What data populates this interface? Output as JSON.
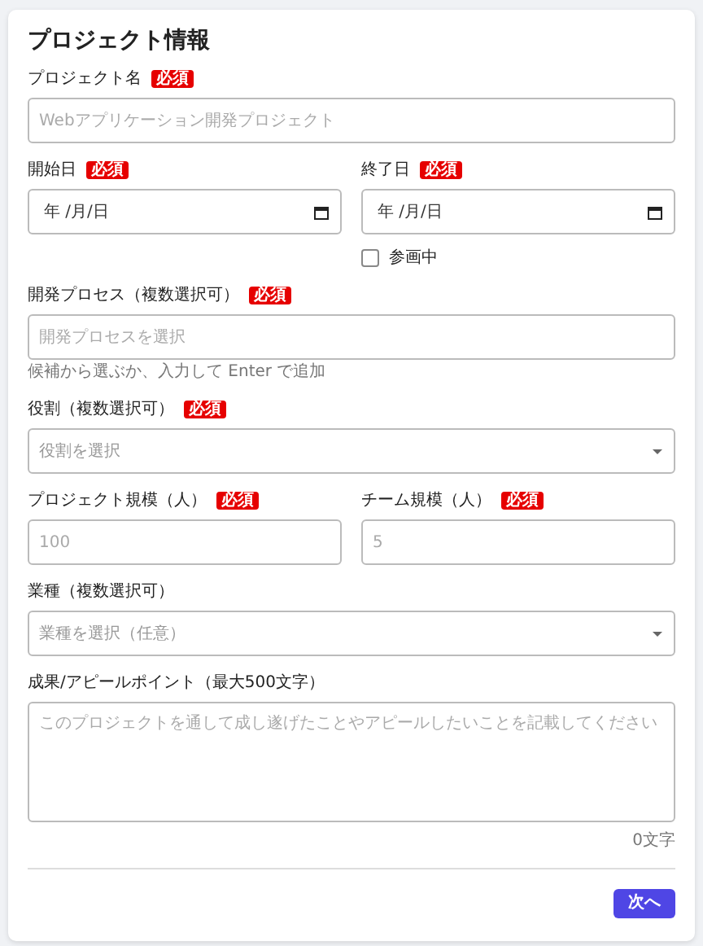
{
  "title": "プロジェクト情報",
  "rows": [
    {
      "fields": [
        {
          "kind": "text",
          "label": "プロジェクト名",
          "badge": "必須",
          "placeholder": "Webアプリケーション開発プロジェクト"
        }
      ]
    },
    {
      "fields": [
        {
          "kind": "date",
          "label": "開始日",
          "badge": "必須",
          "display": "年 /月/日"
        },
        {
          "kind": "date",
          "label": "終了日",
          "badge": "必須",
          "display": "年 /月/日",
          "checkbox": {
            "label": "参画中",
            "checked": false
          }
        }
      ]
    },
    {
      "fields": [
        {
          "kind": "text",
          "label": "開発プロセス（複数選択可）",
          "badge": "必須",
          "placeholder": "開発プロセスを選択",
          "help": "候補から選ぶか、入力して Enter で追加"
        }
      ]
    },
    {
      "fields": [
        {
          "kind": "select",
          "label": "役割（複数選択可）",
          "badge": "必須",
          "placeholder": "役割を選択"
        }
      ]
    },
    {
      "fields": [
        {
          "kind": "text",
          "label": "プロジェクト規模（人）",
          "badge": "必須",
          "placeholder": "100"
        },
        {
          "kind": "text",
          "label": "チーム規模（人）",
          "badge": "必須",
          "placeholder": "5"
        }
      ]
    },
    {
      "fields": [
        {
          "kind": "select",
          "label": "業種（複数選択可）",
          "placeholder": "業種を選択（任意）"
        }
      ]
    },
    {
      "fields": [
        {
          "kind": "textarea",
          "label": "成果/アピールポイント（最大500文字）",
          "placeholder": "このプロジェクトを通して成し遂げたことやアピールしたいことを記載してください",
          "counter": "0文字"
        }
      ]
    }
  ],
  "next_button": "次へ"
}
